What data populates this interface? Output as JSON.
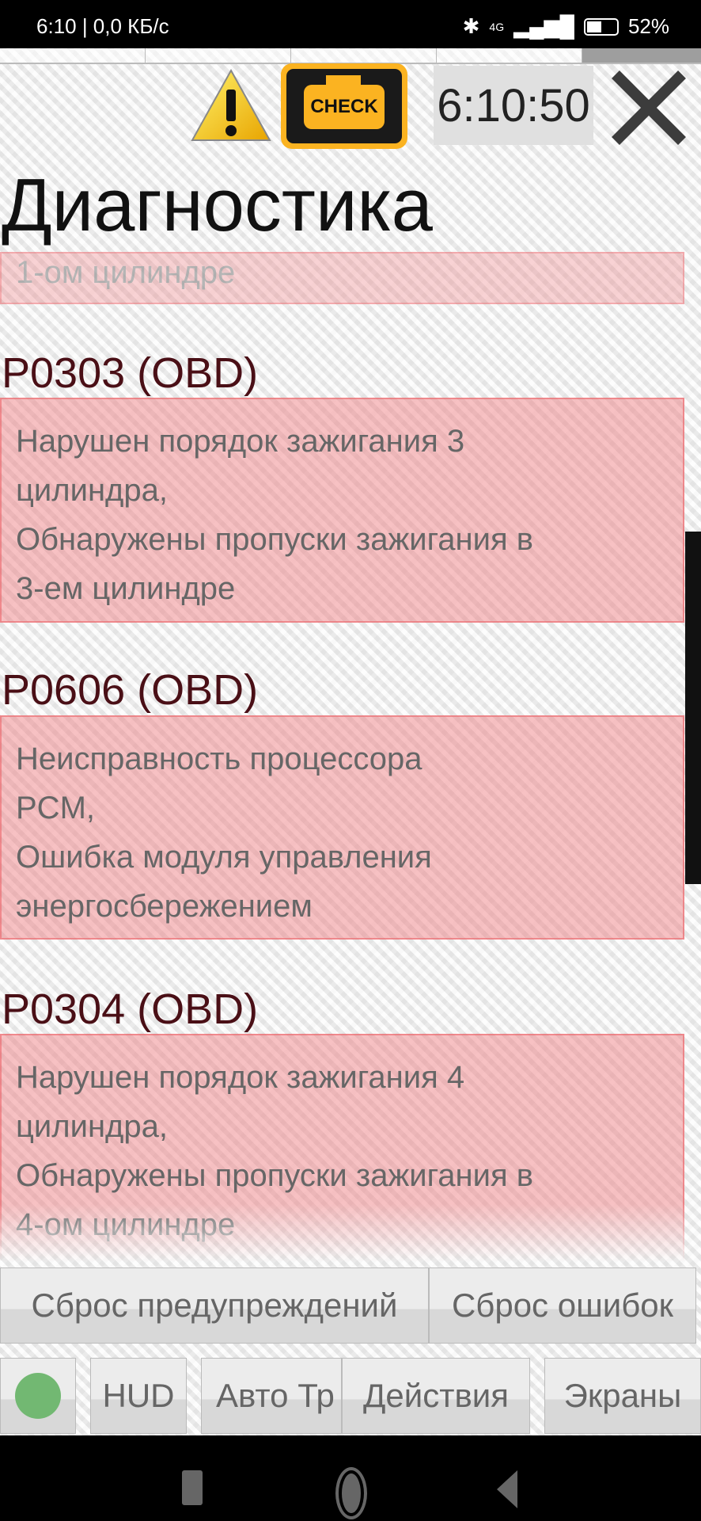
{
  "status_bar": {
    "left": "6:10 | 0,0 КБ/с",
    "battery": "52%",
    "network": "4G"
  },
  "header": {
    "clock": "6:10:50",
    "warning_icon": "warning-triangle",
    "check_engine_label": "CHECK"
  },
  "title": "Диагностика",
  "partial_item": {
    "text": "1-ом цилиндре"
  },
  "errors": [
    {
      "code": "P0303 (OBD)",
      "lines": [
        "Нарушен порядок зажигания 3",
        "цилиндра,",
        "Обнаружены пропуски зажигания в",
        "3-ем цилиндре"
      ]
    },
    {
      "code": "P0606 (OBD)",
      "lines": [
        "Неисправность процессора",
        "PCM,",
        "Ошибка модуля управления",
        "энергосбережением"
      ]
    },
    {
      "code": "P0304 (OBD)",
      "lines": [
        "Нарушен порядок зажигания 4",
        "цилиндра,",
        "Обнаружены пропуски зажигания в",
        "4-ом цилиндре"
      ]
    }
  ],
  "actions": {
    "reset_warnings": "Сброс предупреждений",
    "reset_errors": "Сброс ошибок"
  },
  "bottom_bar": {
    "hud": "HUD",
    "auto": "Авто Тр",
    "actions": "Действия",
    "screens": "Экраны",
    "status_color": "#72b872"
  },
  "colors": {
    "error_bg": "#f0787d",
    "code_text": "#4a0f16",
    "check_engine": "#fbb321"
  }
}
